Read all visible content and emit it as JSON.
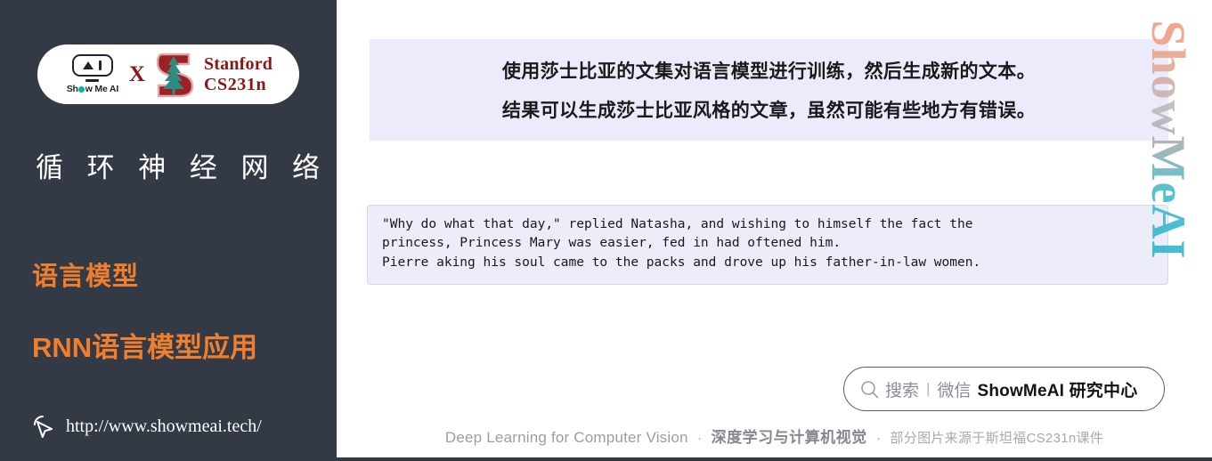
{
  "sidebar": {
    "logo": {
      "showmeai_word": "Show Me AI",
      "showmeai_word_pre": "Sh",
      "showmeai_word_post": "w Me AI",
      "cross": "X",
      "stanford_line1": "Stanford",
      "stanford_line2": "CS231n"
    },
    "title": "循 环 神 经 网 络",
    "subtitle_1": "语言模型",
    "subtitle_2": "RNN语言模型应用",
    "url": "http://www.showmeai.tech/",
    "colors": {
      "background": "#343a45",
      "accent_orange": "#ef7f2e",
      "stanford_red": "#8c1515",
      "teal": "#00b3a4"
    }
  },
  "main": {
    "banner": {
      "line_1": "使用莎士比亚的文集对语言模型进行训练，然后生成新的文本。",
      "line_2": "结果可以生成莎士比亚风格的文章，虽然可能有些地方有错误。",
      "background": "#ecebfb"
    },
    "code_block": {
      "background": "#ecedf8",
      "lines": [
        "\"Why do what that day,\" replied Natasha, and wishing to himself the fact the",
        "princess, Princess Mary was easier, fed in had oftened him.",
        "Pierre aking his soul came to the packs and drove up his father-in-law women."
      ]
    },
    "search_pill": {
      "search_label": "搜索",
      "separator": "|",
      "wechat_label": "微信",
      "brand": "ShowMeAI 研究中心"
    },
    "footer": {
      "english": "Deep Learning for Computer Vision",
      "dot_1": "·",
      "chinese_bold": "深度学习与计算机视觉",
      "dot_2": "·",
      "chinese_light": "部分图片来源于斯坦福CS231n课件"
    },
    "watermark": "ShowMeAI"
  }
}
